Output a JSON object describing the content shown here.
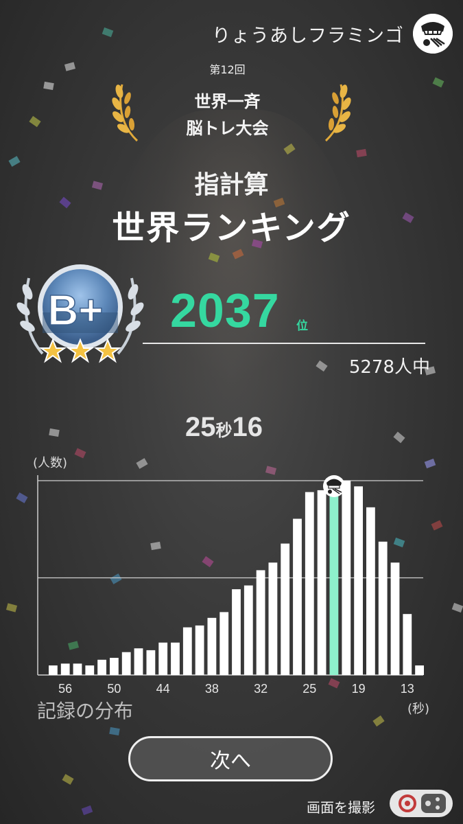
{
  "header": {
    "user_name": "りょうあしフラミンゴ",
    "avatar_icon": "flamingo-face-icon"
  },
  "event": {
    "round_label": "第12回",
    "title_line1": "世界一斉",
    "title_line2": "脳トレ大会",
    "laurel_icon": "gold-laurel-icon"
  },
  "game": {
    "name": "指計算",
    "ranking_title": "世界ランキング"
  },
  "result": {
    "grade": "B+",
    "grade_stars": 3,
    "rank": "2037",
    "rank_unit": "位",
    "participants": "5278人中",
    "record_seconds": "25",
    "record_unit": "秒",
    "record_fraction": "16"
  },
  "chart_data": {
    "type": "bar",
    "title": "記録の分布",
    "xlabel": "(秒)",
    "ylabel": "(人数)",
    "x_ticks": [
      "56",
      "50",
      "44",
      "38",
      "32",
      "25",
      "19",
      "13"
    ],
    "values": [
      5,
      6,
      6,
      5,
      8,
      9,
      12,
      14,
      13,
      17,
      17,
      25,
      26,
      30,
      33,
      45,
      47,
      55,
      59,
      69,
      82,
      96,
      97,
      97,
      102,
      99,
      88,
      70,
      59,
      32,
      5
    ],
    "highlight_index": 23,
    "highlight_color": "#8ef0cc",
    "bar_color": "#ffffff",
    "ylim": [
      0,
      102
    ],
    "gridlines": 2,
    "player_marker_icon": "flamingo-face-icon"
  },
  "actions": {
    "next_label": "次へ",
    "capture_label": "画面を撮影",
    "capture_icon": "controller-icon"
  },
  "colors": {
    "accent": "#35d8a0",
    "gold": "#e0a93a",
    "background": "#3a3a3a"
  }
}
